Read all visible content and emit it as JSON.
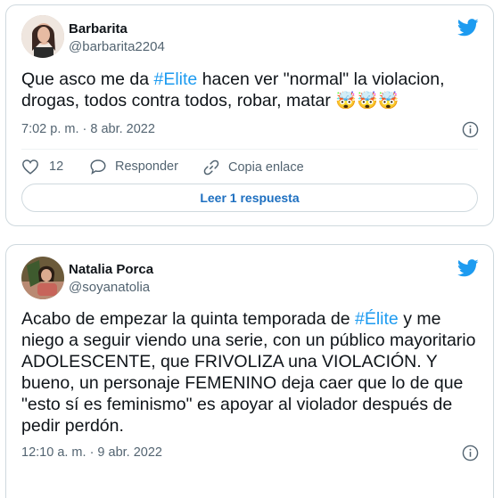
{
  "tweets": [
    {
      "display_name": "Barbarita",
      "handle": "@barbarita2204",
      "text_before": "Que asco me da ",
      "hashtag": "#Elite",
      "text_after": " hacen ver \"normal\" la violacion, drogas, todos contra todos, robar, matar ",
      "emojis": "🤯🤯🤯",
      "timestamp": "7:02 p. m. · 8 abr. 2022",
      "like_count": "12",
      "reply_label": "Responder",
      "copy_label": "Copia enlace",
      "read_replies_label": "Leer 1 respuesta"
    },
    {
      "display_name": "Natalia Porca",
      "handle": "@soyanatolia",
      "text_before": "Acabo de empezar la quinta temporada de ",
      "hashtag": "#Élite",
      "text_after": " y me niego a seguir viendo una serie, con un público mayoritario ADOLESCENTE, que FRIVOLIZA una VIOLACIÓN. Y bueno, un personaje FEMENINO deja caer que lo de que \"esto sí es feminismo\" es apoyar al violador después de pedir perdón.",
      "timestamp": "12:10 a. m. · 9 abr. 2022"
    }
  ],
  "icons": {
    "brand": "twitter-bird-icon",
    "info": "info-icon",
    "like": "heart-icon",
    "reply": "speech-bubble-icon",
    "copy": "link-icon"
  },
  "colors": {
    "twitter_blue": "#1d9bf0",
    "text_primary": "#0f1419",
    "text_secondary": "#536471",
    "border": "#cfd9de"
  }
}
